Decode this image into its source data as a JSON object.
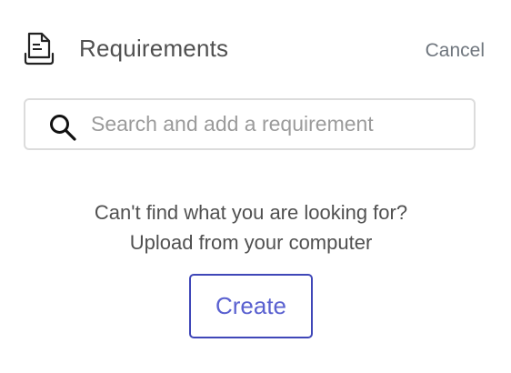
{
  "header": {
    "title": "Requirements",
    "cancel_label": "Cancel",
    "icon": "document-icon"
  },
  "search": {
    "placeholder": "Search and add a requirement",
    "value": "",
    "icon": "search-icon"
  },
  "empty_state": {
    "line1": "Can't find what you are looking for?",
    "line2": "Upload from your computer"
  },
  "actions": {
    "create_label": "Create"
  },
  "colors": {
    "accent": "#3f47b8",
    "accent_text": "#5a61d0",
    "text": "#505050",
    "muted": "#9b9b9b",
    "border": "#dcdcdc"
  }
}
